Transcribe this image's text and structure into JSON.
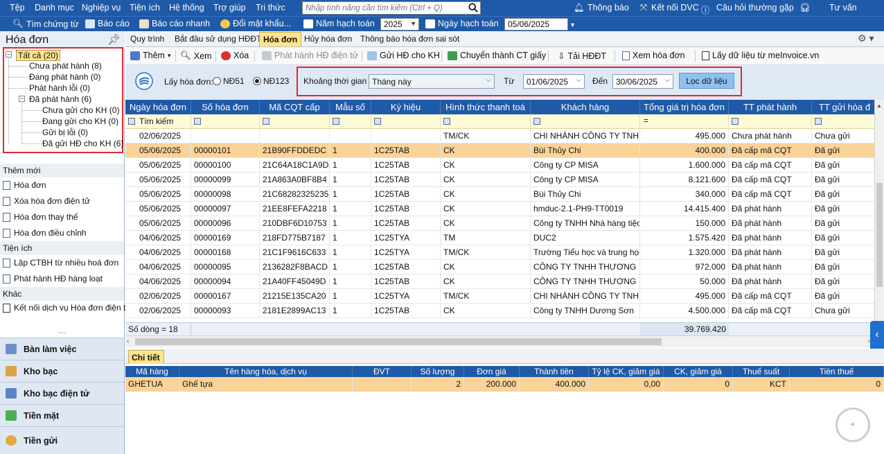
{
  "menubar": {
    "items": [
      "Tệp",
      "Danh mục",
      "Nghiệp vụ",
      "Tiện ích",
      "Hệ thống",
      "Trợ giúp",
      "Tri thức"
    ],
    "search_placeholder": "Nhập tính năng cần tìm kiếm (Ctrl + Q)",
    "right_items": [
      "Thông báo",
      "Kết nối DVC",
      "Câu hỏi thường gặp",
      "Tư vấn"
    ]
  },
  "toolbar": {
    "find_voucher": "Tìm chứng từ",
    "report": "Báo cáo",
    "quick_report": "Báo cáo nhanh",
    "change_password": "Đổi mật khẩu...",
    "fiscal_year_label": "Năm hạch toán",
    "fiscal_year": "2025",
    "posting_date_label": "Ngày hạch toán",
    "posting_date": "05/06/2025"
  },
  "left_panel": {
    "title": "Hóa đơn",
    "tree": {
      "all": "Tất cả (20)",
      "not_issued": "Chưa phát hành (8)",
      "issuing": "Đang phát hành (0)",
      "issue_error": "Phát hành lỗi (0)",
      "issued": "Đã phát hành (6)",
      "not_sent": "Chưa gửi cho KH (0)",
      "sending": "Đang gửi cho KH (0)",
      "send_error": "Gửi bị lỗi (0)",
      "sent": "Đã gửi HĐ cho KH (6)"
    },
    "sections": {
      "new": {
        "title": "Thêm mới",
        "items": [
          "Hóa đơn",
          "Xóa hóa đơn điện tử",
          "Hóa đơn thay thế",
          "Hóa đơn điều chỉnh"
        ]
      },
      "utilities": {
        "title": "Tiện ích",
        "items": [
          "Lập CTBH từ nhiều hoá đơn",
          "Phát hành HĐ hàng loạt"
        ]
      },
      "other": {
        "title": "Khác",
        "items": [
          "Kết nối dịch vụ Hóa đơn điện t"
        ]
      }
    },
    "nav": [
      "Bàn làm việc",
      "Kho bạc",
      "Kho bạc điện tử",
      "Tiền mặt",
      "Tiền gửi"
    ]
  },
  "tabs": [
    "Quy trình",
    "Bắt đầu sử dụng HĐĐT",
    "Hóa đơn",
    "Hủy hóa đơn",
    "Thông báo hóa đơn sai sót"
  ],
  "actions": [
    "Thêm",
    "Xem",
    "Xóa",
    "Phát hành HĐ điện tử",
    "Gửi HĐ cho KH",
    "Chuyển thành CT giấy",
    "Tải HĐĐT",
    "Xem hóa đơn",
    "Lấy dữ liệu từ meInvoice.vn"
  ],
  "filter": {
    "get_invoice_label": "Lấy hóa đơn:",
    "option_nd51": "NĐ51",
    "option_nd123": "NĐ123",
    "period_label": "Khoảng thời gian",
    "period_value": "Tháng này",
    "from_label": "Từ",
    "from_date": "01/06/2025",
    "to_label": "Đến",
    "to_date": "30/06/2025",
    "apply_button": "Lọc dữ liệu"
  },
  "grid": {
    "columns": [
      "Ngày hóa đơn",
      "Số hóa đơn",
      "Mã CQT cấp",
      "Mẫu số",
      "Ký hiệu",
      "Hình thức thanh toá",
      "Khách hàng",
      "Tổng giá trị hóa đơn",
      "TT phát hành",
      "TT gửi hóa đ"
    ],
    "search_label": "Tìm kiếm",
    "rows": [
      [
        "02/06/2025",
        "",
        "",
        "",
        "",
        "TM/CK",
        "CHI NHÁNH CÔNG TY TNH",
        "495.000",
        "Chưa phát hành",
        "Chưa gửi"
      ],
      [
        "05/06/2025",
        "00000101",
        "21B90FFDDEDC",
        "1",
        "1C25TAB",
        "CK",
        "Bùi Thủy Chi",
        "400.000",
        "Đã cấp mã CQT",
        "Đã gửi"
      ],
      [
        "05/06/2025",
        "00000100",
        "21C64A18C1A9D",
        "1",
        "1C25TAB",
        "CK",
        "Công ty CP MISA",
        "1.600.000",
        "Đã cấp mã CQT",
        "Đã gửi"
      ],
      [
        "05/06/2025",
        "00000099",
        "21A863A0BF8B4",
        "1",
        "1C25TAB",
        "CK",
        "Công ty CP MISA",
        "8.121.600",
        "Đã cấp mã CQT",
        "Đã gửi"
      ],
      [
        "05/06/2025",
        "00000098",
        "21C68282325235",
        "1",
        "1C25TAB",
        "CK",
        "Bùi Thủy Chi",
        "340.000",
        "Đã cấp mã CQT",
        "Đã gửi"
      ],
      [
        "05/06/2025",
        "00000097",
        "21EE8FEFA2218",
        "1",
        "1C25TAB",
        "CK",
        "hmduc-2.1-PH9-TT0019",
        "14.415.400",
        "Đã phát hành",
        "Đã gửi"
      ],
      [
        "05/06/2025",
        "00000096",
        "210DBF6D10753",
        "1",
        "1C25TAB",
        "CK",
        "Công ty TNHH Nhà hàng tiệc",
        "150.000",
        "Đã phát hành",
        "Đã gửi"
      ],
      [
        "04/06/2025",
        "00000169",
        "218FD775B7187",
        "1",
        "1C25TYA",
        "TM",
        "DUC2",
        "1.575.420",
        "Đã phát hành",
        "Đã gửi"
      ],
      [
        "04/06/2025",
        "00000168",
        "21C1F9616C633",
        "1",
        "1C25TYA",
        "TM/CK",
        "Trường Tiểu học và trung học",
        "1.320.000",
        "Đã phát hành",
        "Đã gửi"
      ],
      [
        "04/06/2025",
        "00000095",
        "2136282F8BACD",
        "1",
        "1C25TAB",
        "CK",
        "CÔNG TY TNHH THƯƠNG",
        "972.000",
        "Đã phát hành",
        "Đã gửi"
      ],
      [
        "04/06/2025",
        "00000094",
        "21A40FF45049D",
        "1",
        "1C25TAB",
        "CK",
        "CÔNG TY TNHH THƯƠNG",
        "50.000",
        "Đã phát hành",
        "Đã gửi"
      ],
      [
        "02/06/2025",
        "00000167",
        "21215E135CA20",
        "1",
        "1C25TYA",
        "TM/CK",
        "CHI NHÁNH CÔNG TY TNH",
        "495.000",
        "Đã cấp mã CQT",
        "Đã gửi"
      ],
      [
        "02/06/2025",
        "00000093",
        "2181E2899AC13",
        "1",
        "1C25TAB",
        "CK",
        "Công ty TNHH Dương Sơn",
        "4.500.000",
        "Đã cấp mã CQT",
        "Chưa gửi"
      ]
    ],
    "row_count": "Số dòng = 18",
    "total": "39.769.420"
  },
  "detail": {
    "tab": "Chi tiết",
    "columns": [
      "Mã hàng",
      "Tên hàng hóa, dịch vụ",
      "ĐVT",
      "Số lượng",
      "Đơn giá",
      "Thành tiền",
      "Tỷ lệ CK, giảm giá",
      "CK, giảm giá",
      "Thuế suất",
      "Tiền thuế"
    ],
    "row": [
      "GHETUA",
      "Ghế tựa",
      "",
      "2",
      "200.000",
      "400.000",
      "0,00",
      "0",
      "KCT",
      "0"
    ]
  },
  "colors": {
    "primary": "#1f5aa8",
    "selected_row": "#fad398",
    "highlight_box": "#e0282e",
    "active_tab": "#ffe38a"
  }
}
